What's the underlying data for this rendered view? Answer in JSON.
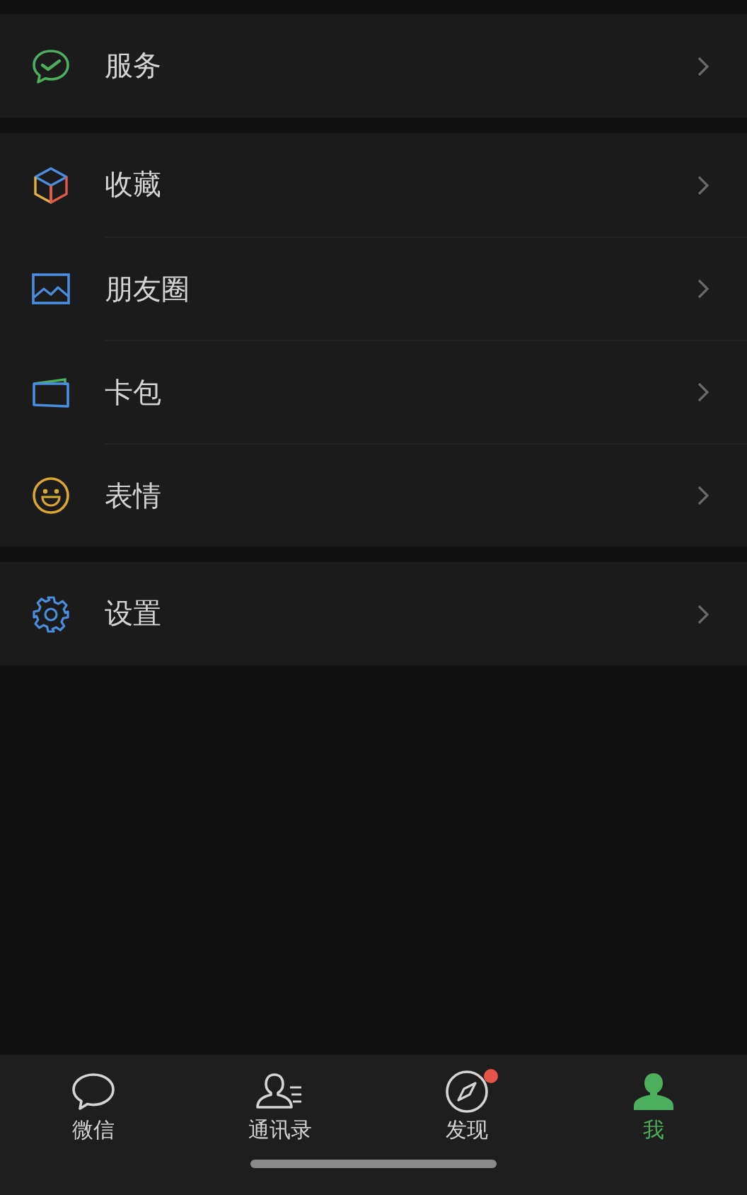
{
  "menu_groups": [
    {
      "items": [
        {
          "label": "服务",
          "kind": "service"
        }
      ]
    },
    {
      "items": [
        {
          "label": "收藏",
          "kind": "favorites"
        },
        {
          "label": "朋友圈",
          "kind": "moments"
        },
        {
          "label": "卡包",
          "kind": "cards"
        },
        {
          "label": "表情",
          "kind": "stickers"
        }
      ]
    },
    {
      "items": [
        {
          "label": "设置",
          "kind": "settings"
        }
      ]
    }
  ],
  "tab_bar": [
    {
      "label": "微信",
      "kind": "chats",
      "selected": false,
      "badge": false
    },
    {
      "label": "通讯录",
      "kind": "contacts",
      "selected": false,
      "badge": false
    },
    {
      "label": "发现",
      "kind": "discover",
      "selected": false,
      "badge": true
    },
    {
      "label": "我",
      "kind": "me",
      "selected": true,
      "badge": false
    }
  ]
}
